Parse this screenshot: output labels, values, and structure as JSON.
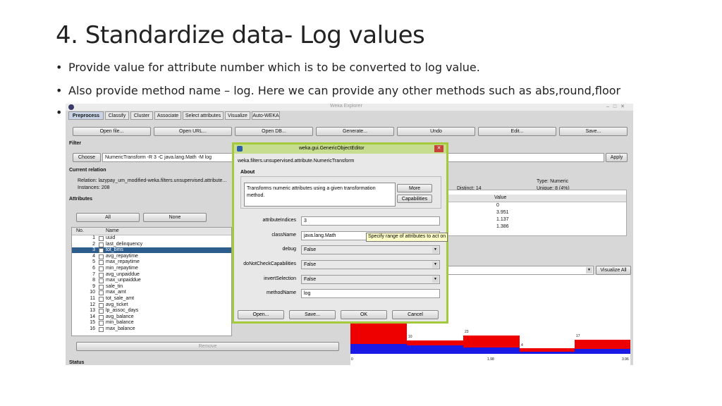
{
  "slide": {
    "title": "4. Standardize data- Log values",
    "bullet_char": "•",
    "bullets": [
      "Provide value for attribute number which is to be converted to log value.",
      "Also provide method name – log. Here we can provide any other methods such as abs,round,floor",
      ""
    ]
  },
  "weka": {
    "window_title": "Weka Explorer",
    "tabs": [
      "Preprocess",
      "Classify",
      "Cluster",
      "Associate",
      "Select attributes",
      "Visualize",
      "Auto-WEKA"
    ],
    "toolbar": [
      "Open file...",
      "Open URL...",
      "Open DB...",
      "Generate...",
      "Undo",
      "Edit...",
      "Save..."
    ],
    "filter": {
      "section": "Filter",
      "choose": "Choose",
      "value": "NumericTransform -R 3 -C java.lang.Math -M log",
      "apply": "Apply"
    },
    "current_relation": {
      "section": "Current relation",
      "relation": "Relation:  lazypay_um_modified-weka.filters.unsupervised.attribute...",
      "instances": "Instances:  208"
    },
    "attributes": {
      "section": "Attributes",
      "buttons": [
        "All",
        "None"
      ],
      "col_no": "No.",
      "col_name": "Name",
      "rows": [
        {
          "n": "1",
          "name": "uuid"
        },
        {
          "n": "2",
          "name": "last_delinquency"
        },
        {
          "n": "3",
          "name": "tot_bms"
        },
        {
          "n": "4",
          "name": "avg_repaytime"
        },
        {
          "n": "5",
          "name": "max_repaytime"
        },
        {
          "n": "6",
          "name": "min_repaytime"
        },
        {
          "n": "7",
          "name": "avg_unpaiddue"
        },
        {
          "n": "8",
          "name": "max_unpaiddue"
        },
        {
          "n": "9",
          "name": "sale_tin"
        },
        {
          "n": "10",
          "name": "max_amt"
        },
        {
          "n": "11",
          "name": "tot_sale_amt"
        },
        {
          "n": "12",
          "name": "avg_ticket"
        },
        {
          "n": "13",
          "name": "lp_assoc_days"
        },
        {
          "n": "14",
          "name": "avg_balance"
        },
        {
          "n": "15",
          "name": "min_balance"
        },
        {
          "n": "16",
          "name": "max_balance"
        }
      ],
      "selected_index": 2,
      "remove": "Remove"
    },
    "status_label": "Status",
    "selected_attribute": {
      "distinct": "Distinct:  14",
      "type": "Type:  Numeric",
      "unique": "Unique:  8 (4%)",
      "value_header": "Value",
      "values": [
        "0",
        "3.951",
        "1.137",
        "1.386"
      ]
    },
    "visualize_all": "Visualize All",
    "histogram": {
      "counts": [
        "10",
        "23",
        "4",
        "17"
      ],
      "x_ticks": [
        "0",
        "1.98",
        "3.96"
      ]
    }
  },
  "dialog": {
    "title": "weka.gui.GenericObjectEditor",
    "class_path": "weka.filters.unsupervised.attribute.NumericTransform",
    "about_label": "About",
    "about_text_1": "Transforms numeric attributes using a given transformation",
    "about_text_2": "method.",
    "more": "More",
    "capabilities": "Capabilities",
    "close_glyph": "✕",
    "fields": [
      {
        "label": "attributeIndices",
        "value": "3",
        "dropdown": false
      },
      {
        "label": "className",
        "value": "java.lang.Math",
        "dropdown": false
      },
      {
        "label": "debug",
        "value": "False",
        "dropdown": true
      },
      {
        "label": "doNotCheckCapabilities",
        "value": "False",
        "dropdown": true
      },
      {
        "label": "invertSelection",
        "value": "False",
        "dropdown": true
      },
      {
        "label": "methodName",
        "value": "log",
        "dropdown": false
      }
    ],
    "tooltip": "Specify range of attributes to act on",
    "buttons": [
      "Open...",
      "Save...",
      "OK",
      "Cancel"
    ]
  }
}
